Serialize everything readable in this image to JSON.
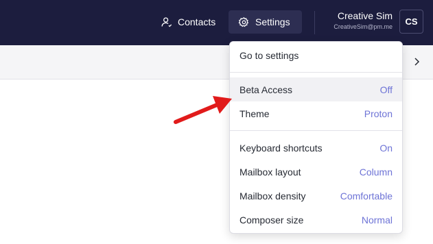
{
  "header": {
    "contacts_label": "Contacts",
    "settings_label": "Settings",
    "user_name": "Creative Sim",
    "user_email": "CreativeSim@pm.me",
    "avatar_initials": "CS"
  },
  "settings_menu": {
    "go_to_settings": "Go to settings",
    "group1": [
      {
        "label": "Beta Access",
        "value": "Off"
      },
      {
        "label": "Theme",
        "value": "Proton"
      }
    ],
    "group2": [
      {
        "label": "Keyboard shortcuts",
        "value": "On"
      },
      {
        "label": "Mailbox layout",
        "value": "Column"
      },
      {
        "label": "Mailbox density",
        "value": "Comfortable"
      },
      {
        "label": "Composer size",
        "value": "Normal"
      }
    ]
  },
  "colors": {
    "header_bg": "#1c1d3e",
    "accent_value": "#6d73d6",
    "annotation_arrow": "#e11b1b"
  }
}
